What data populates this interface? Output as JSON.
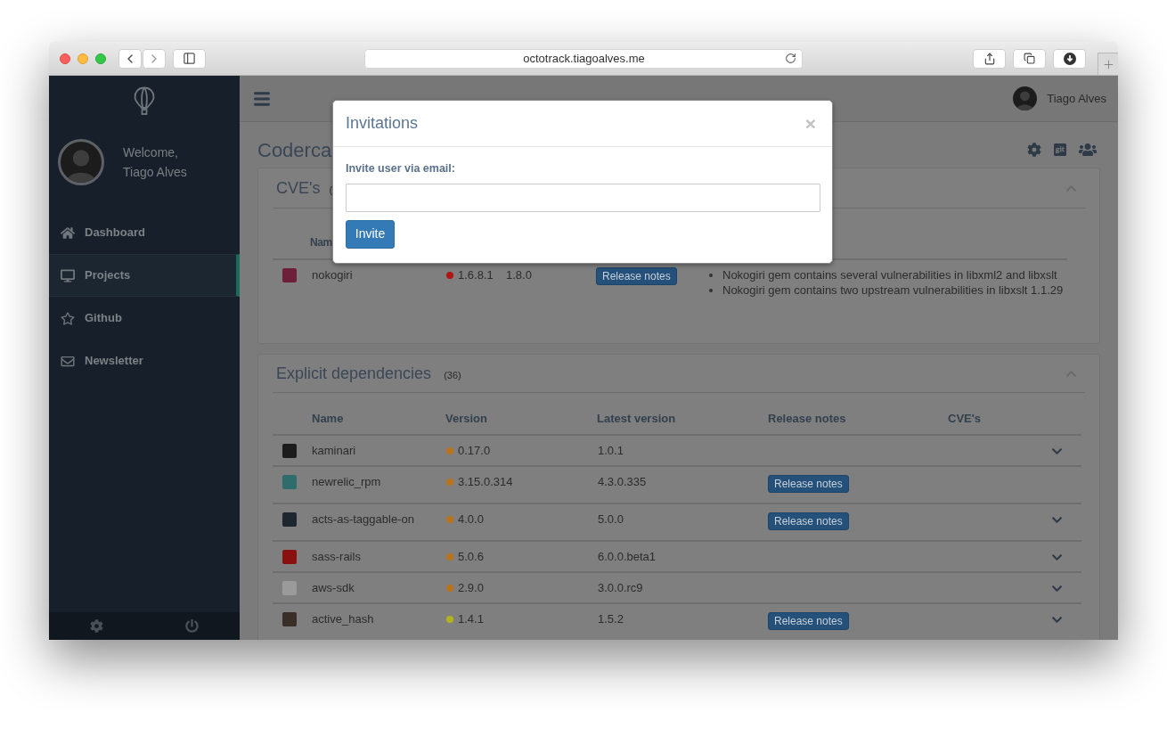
{
  "browser": {
    "url": "octotrack.tiagoalves.me"
  },
  "sidebar": {
    "welcome": "Welcome,",
    "user": "Tiago Alves",
    "items": [
      {
        "label": "Dashboard",
        "selected": false
      },
      {
        "label": "Projects",
        "selected": true
      },
      {
        "label": "Github",
        "selected": false
      },
      {
        "label": "Newsletter",
        "selected": false
      }
    ]
  },
  "header": {
    "user": "Tiago Alves"
  },
  "page": {
    "title": "Coderca"
  },
  "cve_panel": {
    "title": "CVE's",
    "count": "(",
    "columns": [
      "Nam"
    ],
    "rows": [
      {
        "name": "nokogiri",
        "logo": {
          "color": "#6e1f3a"
        },
        "version": {
          "text": "1.6.8.1",
          "color": "#b01616"
        },
        "latest": "1.8.0",
        "release_notes": "Release notes",
        "cves": [
          "Nokogiri gem contains several vulnerabilities in libxml2 and libxslt",
          "Nokogiri gem contains two upstream vulnerabilities in libxslt 1.1.29"
        ]
      }
    ]
  },
  "deps_panel": {
    "title": "Explicit dependencies",
    "count": "(36)",
    "columns": [
      "Name",
      "Version",
      "Latest version",
      "Release notes",
      "CVE's"
    ],
    "rows": [
      {
        "name": "kaminari",
        "logo": {
          "color": "#1c1c1c"
        },
        "version": {
          "text": "0.17.0",
          "color": "#b8741c"
        },
        "latest": "1.0.1",
        "expandable": true
      },
      {
        "name": "newrelic_rpm",
        "logo": {
          "color": "#2f6d6a"
        },
        "version": {
          "text": "3.15.0.314",
          "color": "#b8741c"
        },
        "latest": "4.3.0.335",
        "release_notes": "Release notes",
        "expandable": false
      },
      {
        "name": "acts-as-taggable-on",
        "logo": {
          "color": "#1e2630"
        },
        "version": {
          "text": "4.0.0",
          "color": "#b8741c"
        },
        "latest": "5.0.0",
        "release_notes": "Release notes",
        "expandable": true
      },
      {
        "name": "sass-rails",
        "logo": {
          "color": "#8a1010"
        },
        "version": {
          "text": "5.0.6",
          "color": "#b8741c"
        },
        "latest": "6.0.0.beta1",
        "expandable": true
      },
      {
        "name": "aws-sdk",
        "logo": {
          "color": "#9a9a9a"
        },
        "version": {
          "text": "2.9.0",
          "color": "#b8741c"
        },
        "latest": "3.0.0.rc9",
        "expandable": true
      },
      {
        "name": "active_hash",
        "logo": {
          "color": "#3a2e28"
        },
        "version": {
          "text": "1.4.1",
          "color": "#b2b21c"
        },
        "latest": "1.5.2",
        "release_notes": "Release notes",
        "expandable": true
      }
    ]
  },
  "modal": {
    "title": "Invitations",
    "close": "×",
    "label": "Invite user via email:",
    "button": "Invite"
  }
}
